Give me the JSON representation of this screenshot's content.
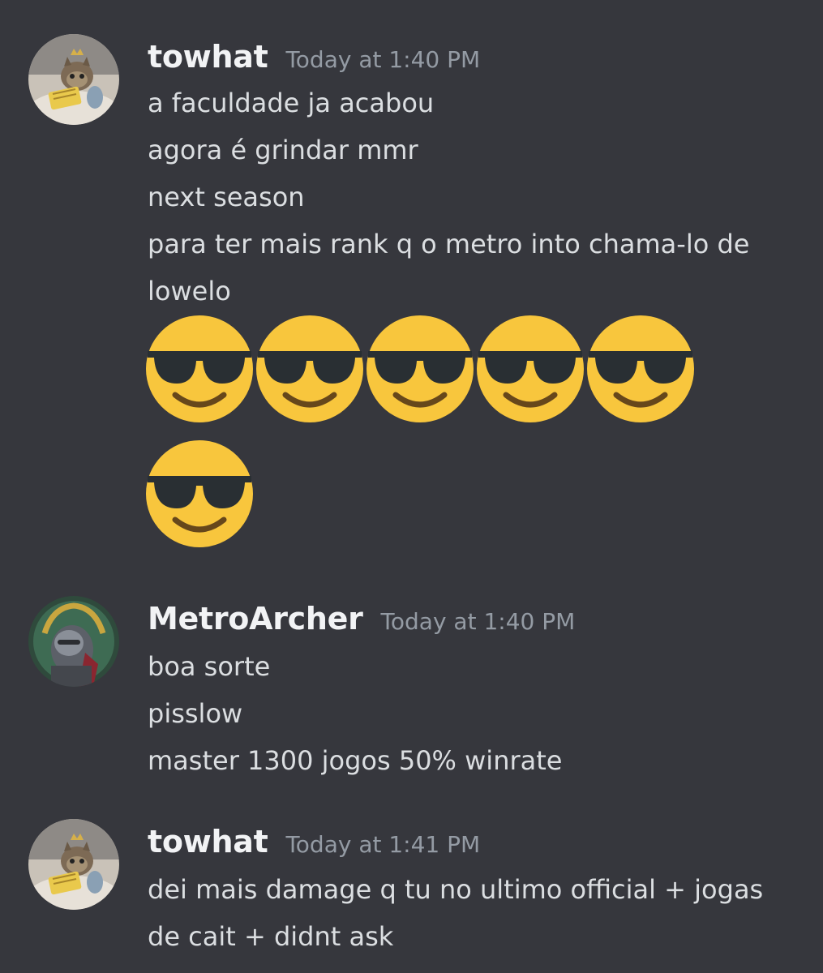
{
  "messages": [
    {
      "username": "towhat",
      "timestamp": "Today at 1:40 PM",
      "avatar": "cat-avatar-icon",
      "lines": [
        "a faculdade ja acabou",
        "agora é grindar mmr",
        "next season",
        "para ter mais rank q o metro into chama-lo de",
        "lowelo"
      ],
      "emoji": {
        "name": "sunglasses-emoji",
        "count": 6
      }
    },
    {
      "username": "MetroArcher",
      "timestamp": "Today at 1:40 PM",
      "avatar": "armored-knight-avatar-icon",
      "lines": [
        "boa sorte",
        "pisslow",
        "master 1300 jogos 50% winrate"
      ]
    },
    {
      "username": "towhat",
      "timestamp": "Today at 1:41 PM",
      "avatar": "cat-avatar-icon",
      "lines": [
        "dei mais damage q tu no ultimo official + jogas",
        "de cait + didnt ask"
      ]
    }
  ],
  "colors": {
    "background": "#36373d",
    "username": "#f2f3f5",
    "timestamp": "#949ba4",
    "text": "#dbdee1",
    "emoji_face": "#f8c63d"
  }
}
